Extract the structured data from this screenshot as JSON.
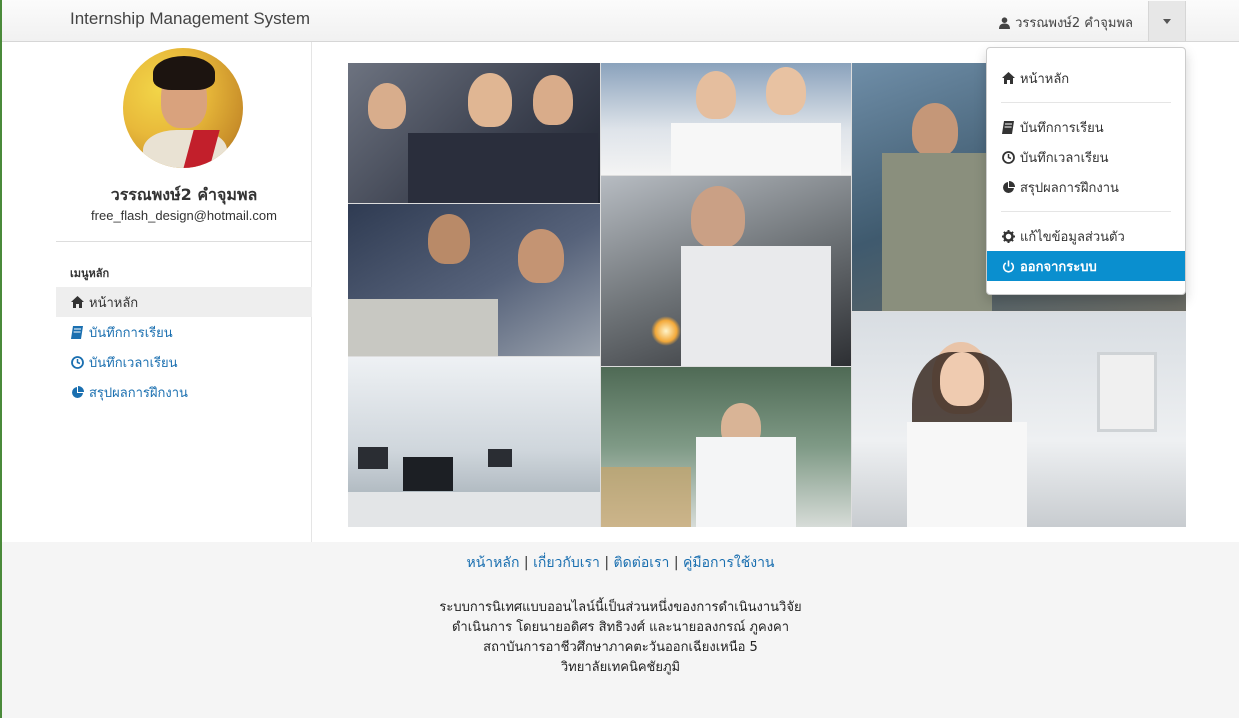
{
  "navbar": {
    "brand": "Internship Management System",
    "user_name": "วรรณพงษ์2 คำจุมพล"
  },
  "profile": {
    "name": "วรรณพงษ์2 คำจุมพล",
    "email": "free_flash_design@hotmail.com"
  },
  "sidebar": {
    "header": "เมนูหลัก",
    "items": [
      {
        "label": "หน้าหลัก",
        "icon": "home-icon"
      },
      {
        "label": "บันทึกการเรียน",
        "icon": "book-icon"
      },
      {
        "label": "บันทึกเวลาเรียน",
        "icon": "clock-icon"
      },
      {
        "label": "สรุปผลการฝึกงาน",
        "icon": "pie-chart-icon"
      }
    ]
  },
  "dropdown": {
    "items": [
      {
        "label": "หน้าหลัก",
        "icon": "home-icon"
      },
      {
        "label": "บันทึกการเรียน",
        "icon": "book-icon"
      },
      {
        "label": "บันทึกเวลาเรียน",
        "icon": "clock-icon"
      },
      {
        "label": "สรุปผลการฝึกงาน",
        "icon": "pie-chart-icon"
      },
      {
        "label": "แก้ไขข้อมูลส่วนตัว",
        "icon": "cog-icon"
      },
      {
        "label": "ออกจากระบบ",
        "icon": "power-icon"
      }
    ]
  },
  "footer": {
    "links": [
      "หน้าหลัก",
      "เกี่ยวกับเรา",
      "ติดต่อเรา",
      "คู่มือการใช้งาน"
    ],
    "separator": "|",
    "lines": [
      "ระบบการนิเทศแบบออนไลน์นี้เป็นส่วนหนึ่งของการดำเนินงานวิจัย",
      "ดำเนินการ โดยนายอดิศร สิทธิวงศ์ และนายอลงกรณ์ ภูคงคา",
      "สถาบันการอาชีวศึกษาภาคตะวันออกเฉียงเหนือ 5",
      "วิทยาลัยเทคนิคชัยภูมิ"
    ]
  },
  "colors": {
    "link": "#1a6fb0",
    "active_dropdown": "#0a8fcf"
  }
}
